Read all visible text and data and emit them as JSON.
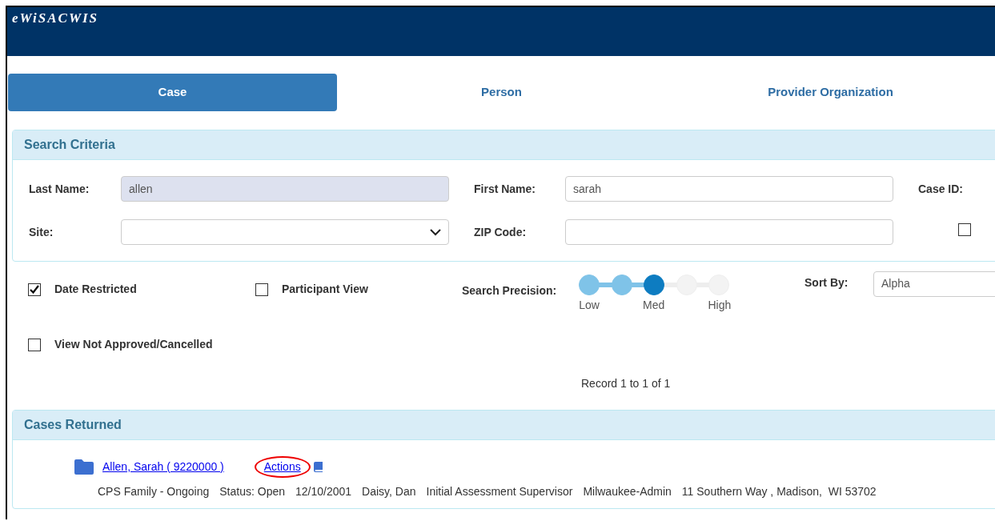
{
  "app": {
    "title": "eWiSACWIS"
  },
  "tabs": [
    {
      "label": "Case",
      "selected": true
    },
    {
      "label": "Person",
      "selected": false
    },
    {
      "label": "Provider Organization",
      "selected": false
    }
  ],
  "search_criteria": {
    "title": "Search Criteria",
    "fields": [
      {
        "kind": "text",
        "label": "Last Name:",
        "value": "allen",
        "focused": true
      },
      {
        "kind": "text",
        "label": "First Name:",
        "value": "sarah",
        "focused": false
      },
      {
        "kind": "label",
        "label": "Case ID:"
      },
      {
        "kind": "select",
        "label": "Site:"
      },
      {
        "kind": "text",
        "label": "ZIP Code:",
        "focused": false
      },
      {
        "kind": "checkbox",
        "checked": false
      }
    ]
  },
  "options": [
    {
      "label": "Date Restricted",
      "checked": true
    },
    {
      "label": "Participant View",
      "checked": false
    },
    {
      "label": "View Not Approved/Cancelled",
      "checked": false
    }
  ],
  "search_precision": {
    "label": "Search Precision:",
    "level": 0.5,
    "ticks": [
      "Low",
      "Med",
      "High"
    ]
  },
  "sort_by": {
    "label": "Sort By:",
    "value": "Alpha"
  },
  "record_count": "Record 1 to 1 of 1",
  "cases_returned": {
    "title": "Cases Returned",
    "cases": [
      {
        "name": "Allen, Sarah ( 9220000 )",
        "action": "Actions",
        "action_circled": true,
        "details": [
          "CPS Family - Ongoing",
          "Status: Open",
          "12/10/2001",
          "Daisy, Dan",
          "Initial Assessment Supervisor",
          "Milwaukee-Admin",
          "11 Southern Way , Madison,  WI 53702"
        ]
      }
    ]
  }
}
